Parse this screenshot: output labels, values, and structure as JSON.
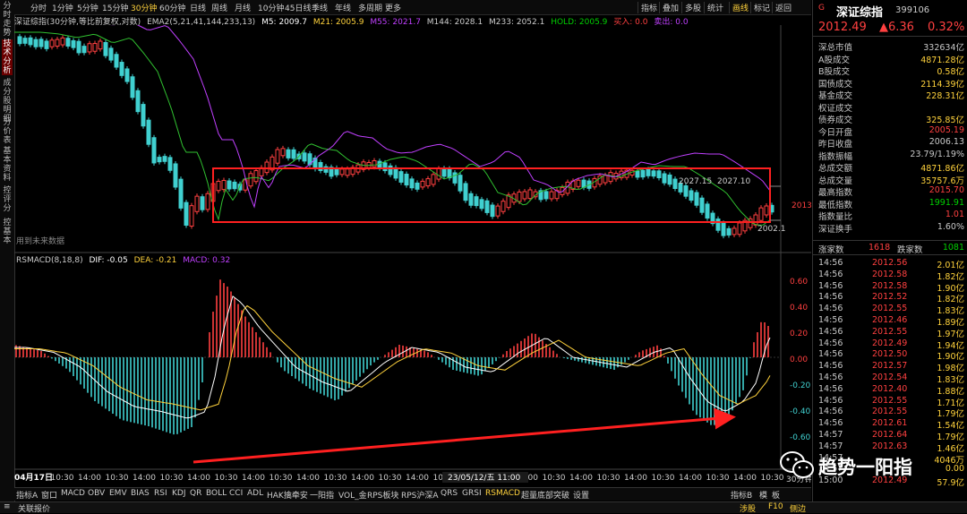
{
  "left_nav": [
    {
      "label": "分时走势",
      "active": false
    },
    {
      "label": "技术分析",
      "active": true
    },
    {
      "label": "成分股明细",
      "active": false
    },
    {
      "label": "分价表",
      "active": false
    },
    {
      "label": "基本资料",
      "active": false
    },
    {
      "label": "控评分",
      "active": false
    },
    {
      "label": "控基本",
      "active": false
    }
  ],
  "period_tabs": [
    {
      "label": "分时",
      "active": false
    },
    {
      "label": "1分钟",
      "active": false
    },
    {
      "label": "5分钟",
      "active": false
    },
    {
      "label": "15分钟",
      "active": false
    },
    {
      "label": "30分钟",
      "active": true
    },
    {
      "label": "60分钟",
      "active": false
    },
    {
      "label": "日线",
      "active": false
    },
    {
      "label": "周线",
      "active": false
    },
    {
      "label": "月线",
      "active": false
    },
    {
      "label": "10分钟",
      "active": false
    },
    {
      "label": "45日线",
      "active": false
    },
    {
      "label": "季线",
      "active": false
    },
    {
      "label": "年线",
      "active": false
    },
    {
      "label": "多周期",
      "active": false
    },
    {
      "label": "更多",
      "active": false
    }
  ],
  "right_tools": [
    "指标",
    "叠加",
    "多股",
    "统计",
    "画线",
    "标记",
    "返回"
  ],
  "ma_legend": {
    "name": "深证综指(30分钟,等比前复权,对数)",
    "ema": "EMA2(5,21,41,144,233,13)",
    "m5": "M5: 2009.7",
    "m21": "M21: 2005.9",
    "m55": "M55: 2021.7",
    "m144": "M144: 2028.1",
    "m233": "M233: 2052.1",
    "hold": "HOLD: 2005.9",
    "buy": "买入: 0.0",
    "sell": "卖出: 0.0"
  },
  "price_annotations": {
    "left_level": "2027.15",
    "right_level": "2027.10",
    "low": "2002.1",
    "current": "2013",
    "future_note": "用到未来数据"
  },
  "macd_legend": {
    "name": "RSMACD(8,18,8)",
    "dif": "DIF: -0.05",
    "dea": "DEA: -0.21",
    "macd": "MACD: 0.32"
  },
  "macd_axis": [
    "0.60",
    "0.40",
    "0.20",
    "0.00",
    "-0.20",
    "-0.40",
    "-0.60"
  ],
  "time_axis": [
    "04月17日",
    "10:30",
    "14:00",
    "10:30",
    "14:00",
    "10:30",
    "14:00",
    "10:30",
    "14:00",
    "10:30",
    "14:00",
    "10:30",
    "14:00",
    "10:30",
    "14:00",
    "10:30",
    "14:00",
    "10:30",
    "14:00",
    "10:30",
    "14:00",
    "10:30",
    "14:00",
    "10:30",
    "14:00",
    "10:30",
    "14:00",
    "10:30"
  ],
  "time_axis_center": "23/05/12/五 11:00",
  "time_axis_end": "30分钟",
  "indicators": [
    {
      "label": "指标A",
      "active": false
    },
    {
      "label": "窗口",
      "active": false
    },
    {
      "label": "MACD",
      "active": false
    },
    {
      "label": "OBV",
      "active": false
    },
    {
      "label": "EMV",
      "active": false
    },
    {
      "label": "BIAS",
      "active": false
    },
    {
      "label": "RSI",
      "active": false
    },
    {
      "label": "KDJ",
      "active": false
    },
    {
      "label": "QR",
      "active": false
    },
    {
      "label": "BOLL",
      "active": false
    },
    {
      "label": "CCI",
      "active": false
    },
    {
      "label": "ADL",
      "active": false
    },
    {
      "label": "HAK擒牵安",
      "active": false
    },
    {
      "label": "一阳指",
      "active": false
    },
    {
      "label": "VOL_金",
      "active": false
    },
    {
      "label": "RPS板块",
      "active": false
    },
    {
      "label": "RPS沪深A",
      "active": false
    },
    {
      "label": "QRS",
      "active": false
    },
    {
      "label": "GRSI",
      "active": false
    },
    {
      "label": "RSMACD",
      "active": true
    },
    {
      "label": "超量底部突破",
      "active": false
    },
    {
      "label": "设置",
      "active": false
    }
  ],
  "ind_right": [
    "指标B",
    "模",
    "板"
  ],
  "bottom": {
    "left": "关联报价",
    "mid": "涉股",
    "f10": "F10",
    "side": "侧边"
  },
  "quote": {
    "name": "深证综指",
    "code": "399106",
    "price": "2012.49",
    "change": "▲6.36",
    "pct": "0.32%",
    "rows": [
      {
        "k": "深总市值",
        "v": "332634亿",
        "c": "#c8c8c8"
      },
      {
        "k": "A股成交",
        "v": "4871.28亿",
        "c": "#ffd23c"
      },
      {
        "k": "B股成交",
        "v": "0.58亿",
        "c": "#ffd23c"
      },
      {
        "k": "国债成交",
        "v": "2114.39亿",
        "c": "#ffd23c"
      },
      {
        "k": "基金成交",
        "v": "228.31亿",
        "c": "#ffd23c"
      },
      {
        "k": "权证成交",
        "v": "",
        "c": "#ffd23c"
      },
      {
        "k": "债券成交",
        "v": "325.85亿",
        "c": "#ffd23c"
      },
      {
        "k": "今日开盘",
        "v": "2005.19",
        "c": "#ff4040"
      },
      {
        "k": "昨日收盘",
        "v": "2006.13",
        "c": "#c8c8c8"
      },
      {
        "k": "指数振幅",
        "v": "23.79/1.19%",
        "c": "#c8c8c8"
      },
      {
        "k": "总成交额",
        "v": "4871.86亿",
        "c": "#ffd23c"
      },
      {
        "k": "总成交量",
        "v": "35757.6万",
        "c": "#ffd23c"
      },
      {
        "k": "最高指数",
        "v": "2015.70",
        "c": "#ff4040"
      },
      {
        "k": "最低指数",
        "v": "1991.91",
        "c": "#00d000"
      },
      {
        "k": "指数量比",
        "v": "1.01",
        "c": "#ff4040"
      },
      {
        "k": "深证换手",
        "v": "1.60%",
        "c": "#c8c8c8"
      }
    ],
    "rise_label": "涨家数",
    "rise": "1618",
    "fall_label": "跌家数",
    "fall": "1081",
    "ticks": [
      {
        "t": "14:56",
        "p": "2012.56",
        "q": "2.01亿"
      },
      {
        "t": "14:56",
        "p": "2012.58",
        "q": "1.82亿"
      },
      {
        "t": "14:56",
        "p": "2012.58",
        "q": "1.90亿"
      },
      {
        "t": "14:56",
        "p": "2012.52",
        "q": "1.82亿"
      },
      {
        "t": "14:56",
        "p": "2012.55",
        "q": "1.83亿"
      },
      {
        "t": "14:56",
        "p": "2012.46",
        "q": "1.89亿"
      },
      {
        "t": "14:56",
        "p": "2012.55",
        "q": "1.97亿"
      },
      {
        "t": "14:56",
        "p": "2012.49",
        "q": "1.94亿"
      },
      {
        "t": "14:56",
        "p": "2012.50",
        "q": "1.90亿"
      },
      {
        "t": "14:56",
        "p": "2012.57",
        "q": "1.98亿"
      },
      {
        "t": "14:56",
        "p": "2012.54",
        "q": "1.83亿"
      },
      {
        "t": "14:56",
        "p": "2012.40",
        "q": "1.88亿"
      },
      {
        "t": "14:56",
        "p": "2012.55",
        "q": "1.71亿"
      },
      {
        "t": "14:56",
        "p": "2012.55",
        "q": "1.79亿"
      },
      {
        "t": "14:56",
        "p": "2012.61",
        "q": "1.54亿"
      },
      {
        "t": "14:57",
        "p": "2012.64",
        "q": "1.79亿"
      },
      {
        "t": "14:57",
        "p": "2012.63",
        "q": "1.46亿"
      },
      {
        "t": "14:57",
        "p": "",
        "q": "4046万"
      },
      {
        "t": "14:57",
        "p": "",
        "q": "0.00"
      },
      {
        "t": "15:00",
        "p": "2012.49",
        "q": "57.9亿"
      }
    ]
  },
  "watermark": "趋势一阳指",
  "colors": {
    "up": "#ff4040",
    "down": "#40d0d0",
    "ma5": "#ffffff",
    "ma21": "#ffd23c",
    "ma55": "#c040ff",
    "box": "#ff2020"
  }
}
